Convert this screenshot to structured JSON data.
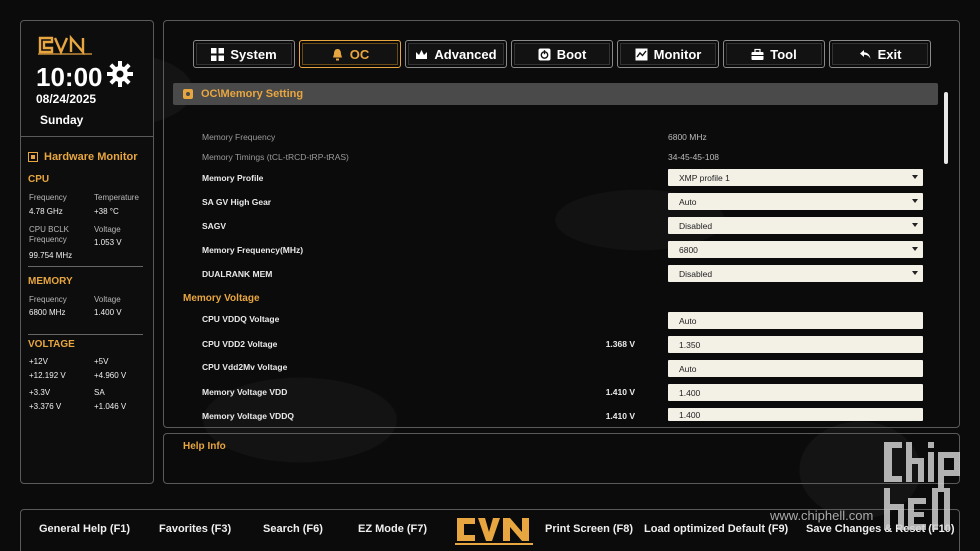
{
  "brand": {
    "logo_text": "CVN"
  },
  "clock": {
    "time": "10:00",
    "date": "08/24/2025",
    "day": "Sunday"
  },
  "hardware_monitor": {
    "title": "Hardware Monitor",
    "cpu": {
      "title": "CPU",
      "frequency_label": "Frequency",
      "frequency": "4.78 GHz",
      "temperature_label": "Temperature",
      "temperature": "+38 °C",
      "bclk_label_1": "CPU BCLK",
      "bclk_label_2": "Frequency",
      "bclk": "99.754 MHz",
      "voltage_label": "Voltage",
      "voltage": "1.053 V"
    },
    "memory": {
      "title": "MEMORY",
      "frequency_label": "Frequency",
      "frequency": "6800 MHz",
      "voltage_label": "Voltage",
      "voltage": "1.400 V"
    },
    "voltage": {
      "title": "VOLTAGE",
      "v12_label": "+12V",
      "v12": "+12.192 V",
      "v5_label": "+5V",
      "v5": "+4.960 V",
      "v33_label": "+3.3V",
      "v33": "+3.376 V",
      "sa_label": "SA",
      "sa": "+1.046 V"
    }
  },
  "tabs": [
    {
      "label": "System",
      "icon": "grid-icon"
    },
    {
      "label": "OC",
      "icon": "bell-icon",
      "active": true
    },
    {
      "label": "Advanced",
      "icon": "crown-icon"
    },
    {
      "label": "Boot",
      "icon": "power-icon"
    },
    {
      "label": "Monitor",
      "icon": "chart-icon"
    },
    {
      "label": "Tool",
      "icon": "toolbox-icon"
    },
    {
      "label": "Exit",
      "icon": "return-arrow-icon"
    }
  ],
  "breadcrumb": "OC\\Memory Setting",
  "settings": {
    "memory_frequency_label": "Memory Frequency",
    "memory_frequency": "6800 MHz",
    "memory_timings_label": "Memory Timings (tCL-tRCD-tRP-tRAS)",
    "memory_timings": "34-45-45-108",
    "memory_profile_label": "Memory Profile",
    "memory_profile": "XMP profile 1",
    "sa_gv_label": "SA GV High Gear",
    "sa_gv": "Auto",
    "sagv_label": "SAGV",
    "sagv": "Disabled",
    "memory_freq_mhz_label": "Memory Frequency(MHz)",
    "memory_freq_mhz": "6800",
    "dualrank_label": "DUALRANK MEM",
    "dualrank": "Disabled",
    "memory_voltage_title": "Memory Voltage",
    "cpu_vddq_label": "CPU VDDQ Voltage",
    "cpu_vddq": "Auto",
    "cpu_vdd2_label": "CPU VDD2 Voltage",
    "cpu_vdd2_current": "1.368 V",
    "cpu_vdd2": "1.350",
    "cpu_vdd2mv_label": "CPU Vdd2Mv Voltage",
    "cpu_vdd2mv": "Auto",
    "mem_vdd_label": "Memory Voltage VDD",
    "mem_vdd_current": "1.410 V",
    "mem_vdd": "1.400",
    "mem_vddq_label": "Memory Voltage VDDQ",
    "mem_vddq_current": "1.410 V",
    "mem_vddq": "1.400"
  },
  "help": {
    "title": "Help Info"
  },
  "footer": {
    "general_help": "General Help (F1)",
    "favorites": "Favorites (F3)",
    "search": "Search (F6)",
    "ez_mode": "EZ Mode (F7)",
    "print_screen": "Print Screen (F8)",
    "load_optimized": "Load optimized Default (F9)",
    "save_reset": "Save Changes & Reset (F10)"
  },
  "watermark": {
    "url": "www.chiphell.com",
    "logo_text": "chip hell"
  },
  "colors": {
    "accent": "#e8a640",
    "field_bg": "#f3f0e6",
    "breadcrumb_bg": "#4a4a4a"
  }
}
